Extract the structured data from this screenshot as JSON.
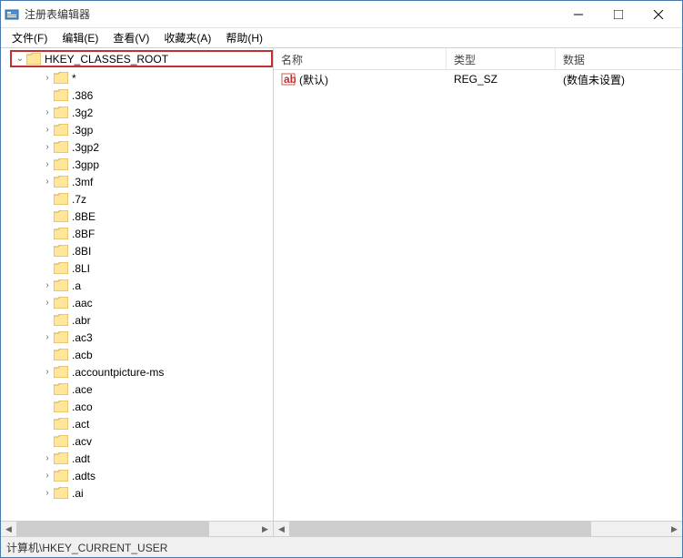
{
  "window": {
    "title": "注册表编辑器"
  },
  "menu": {
    "file": "文件(F)",
    "edit": "编辑(E)",
    "view": "查看(V)",
    "favorites": "收藏夹(A)",
    "help": "帮助(H)"
  },
  "tree": {
    "root": "HKEY_CLASSES_ROOT",
    "items": [
      {
        "label": "*",
        "expandable": true
      },
      {
        "label": ".386",
        "expandable": false
      },
      {
        "label": ".3g2",
        "expandable": true
      },
      {
        "label": ".3gp",
        "expandable": true
      },
      {
        "label": ".3gp2",
        "expandable": true
      },
      {
        "label": ".3gpp",
        "expandable": true
      },
      {
        "label": ".3mf",
        "expandable": true
      },
      {
        "label": ".7z",
        "expandable": false
      },
      {
        "label": ".8BE",
        "expandable": false
      },
      {
        "label": ".8BF",
        "expandable": false
      },
      {
        "label": ".8BI",
        "expandable": false
      },
      {
        "label": ".8LI",
        "expandable": false
      },
      {
        "label": ".a",
        "expandable": true
      },
      {
        "label": ".aac",
        "expandable": true
      },
      {
        "label": ".abr",
        "expandable": false
      },
      {
        "label": ".ac3",
        "expandable": true
      },
      {
        "label": ".acb",
        "expandable": false
      },
      {
        "label": ".accountpicture-ms",
        "expandable": true
      },
      {
        "label": ".ace",
        "expandable": false
      },
      {
        "label": ".aco",
        "expandable": false
      },
      {
        "label": ".act",
        "expandable": false
      },
      {
        "label": ".acv",
        "expandable": false
      },
      {
        "label": ".adt",
        "expandable": true
      },
      {
        "label": ".adts",
        "expandable": true
      },
      {
        "label": ".ai",
        "expandable": true
      }
    ]
  },
  "list": {
    "columns": {
      "name": "名称",
      "type": "类型",
      "data": "数据"
    },
    "rows": [
      {
        "name": "(默认)",
        "type": "REG_SZ",
        "data": "(数值未设置)"
      }
    ]
  },
  "status": {
    "path": "计算机\\HKEY_CURRENT_USER"
  }
}
